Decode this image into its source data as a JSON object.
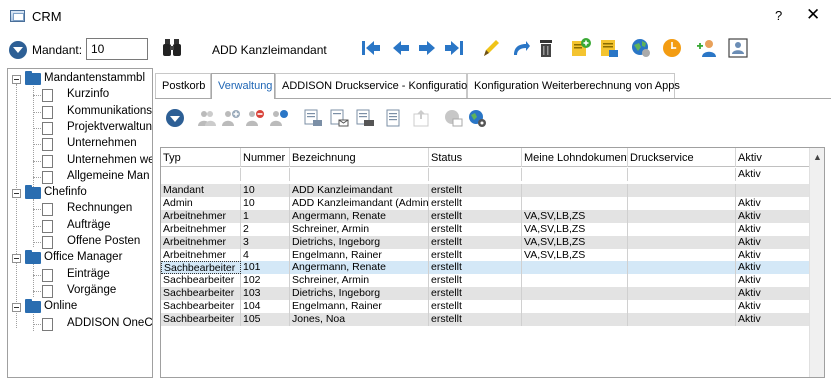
{
  "window": {
    "title": "CRM",
    "help": "?",
    "close": "✕"
  },
  "toolbar": {
    "mandant_label": "Mandant:",
    "mandant_value": "10",
    "mandant_name": "ADD Kanzleimandant"
  },
  "tree": [
    {
      "label": "Mandantenstammbl",
      "kind": "folder"
    },
    {
      "label": "Kurzinfo",
      "kind": "doc"
    },
    {
      "label": "Kommunikations",
      "kind": "doc"
    },
    {
      "label": "Projektverwaltun",
      "kind": "doc"
    },
    {
      "label": "Unternehmen",
      "kind": "doc"
    },
    {
      "label": "Unternehmen we",
      "kind": "doc"
    },
    {
      "label": "Allgemeine Man",
      "kind": "doc"
    },
    {
      "label": "Chefinfo",
      "kind": "folder"
    },
    {
      "label": "Rechnungen",
      "kind": "doc"
    },
    {
      "label": "Aufträge",
      "kind": "doc"
    },
    {
      "label": "Offene Posten",
      "kind": "doc"
    },
    {
      "label": "Office Manager",
      "kind": "folder"
    },
    {
      "label": "Einträge",
      "kind": "doc"
    },
    {
      "label": "Vorgänge",
      "kind": "doc"
    },
    {
      "label": "Online",
      "kind": "folder"
    },
    {
      "label": "ADDISON OneCl",
      "kind": "doc"
    }
  ],
  "tabs": [
    {
      "label": "Postkorb",
      "active": false
    },
    {
      "label": "Verwaltung",
      "active": true
    },
    {
      "label": "ADDISON Druckservice - Konfiguration",
      "active": false
    },
    {
      "label": "Konfiguration Weiterberechnung von Apps",
      "active": false
    }
  ],
  "grid": {
    "columns": [
      "Typ",
      "Nummer",
      "Bezeichnung",
      "Status",
      "Meine Lohndokumente",
      "Druckservice",
      "Aktiv"
    ],
    "filter_row": [
      "",
      "",
      "",
      "",
      "",
      "",
      "Aktiv"
    ],
    "rows": [
      {
        "cells": [
          "Mandant",
          "10",
          "ADD Kanzleimandant",
          "erstellt",
          "",
          "",
          ""
        ],
        "style": "gray"
      },
      {
        "cells": [
          "Admin",
          "10",
          "ADD Kanzleimandant (Admini",
          "erstellt",
          "",
          "",
          "Aktiv"
        ],
        "style": "white"
      },
      {
        "cells": [
          "Arbeitnehmer",
          "1",
          "Angermann, Renate",
          "erstellt",
          "VA,SV,LB,ZS",
          "",
          "Aktiv"
        ],
        "style": "gray"
      },
      {
        "cells": [
          "Arbeitnehmer",
          "2",
          "Schreiner, Armin",
          "erstellt",
          "VA,SV,LB,ZS",
          "",
          "Aktiv"
        ],
        "style": "white"
      },
      {
        "cells": [
          "Arbeitnehmer",
          "3",
          "Dietrichs, Ingeborg",
          "erstellt",
          "VA,SV,LB,ZS",
          "",
          "Aktiv"
        ],
        "style": "gray"
      },
      {
        "cells": [
          "Arbeitnehmer",
          "4",
          "Engelmann, Rainer",
          "erstellt",
          "VA,SV,LB,ZS",
          "",
          "Aktiv"
        ],
        "style": "white"
      },
      {
        "cells": [
          "Sachbearbeiter",
          "101",
          "Angermann, Renate",
          "erstellt",
          "",
          "",
          "Aktiv"
        ],
        "style": "sel"
      },
      {
        "cells": [
          "Sachbearbeiter",
          "102",
          "Schreiner, Armin",
          "erstellt",
          "",
          "",
          "Aktiv"
        ],
        "style": "white"
      },
      {
        "cells": [
          "Sachbearbeiter",
          "103",
          "Dietrichs, Ingeborg",
          "erstellt",
          "",
          "",
          "Aktiv"
        ],
        "style": "gray"
      },
      {
        "cells": [
          "Sachbearbeiter",
          "104",
          "Engelmann, Rainer",
          "erstellt",
          "",
          "",
          "Aktiv"
        ],
        "style": "white"
      },
      {
        "cells": [
          "Sachbearbeiter",
          "105",
          "Jones, Noa",
          "erstellt",
          "",
          "",
          "Aktiv"
        ],
        "style": "gray"
      }
    ]
  },
  "colors": {
    "accent_blue": "#1f66b5",
    "selected_row": "#d4e8f7",
    "alt_row": "#e3e3e3"
  },
  "icons": {
    "toolbar": [
      "first-record-icon",
      "previous-record-icon",
      "next-record-icon",
      "last-record-icon",
      "edit-pencil-icon",
      "undo-icon",
      "delete-trash-icon",
      "new-document-icon",
      "form-icon",
      "globe-icon",
      "clock-icon",
      "add-user-icon",
      "contact-card-icon"
    ],
    "subtoolbar": [
      "dropdown-circle-icon",
      "user-group-icon",
      "add-user-group-icon",
      "remove-user-group-icon",
      "refresh-user-group-icon",
      "print-user-icon",
      "mail-user-icon",
      "print-users-icon",
      "document-icon",
      "export-icon",
      "globe-mail-icon",
      "globe-gear-icon"
    ]
  }
}
